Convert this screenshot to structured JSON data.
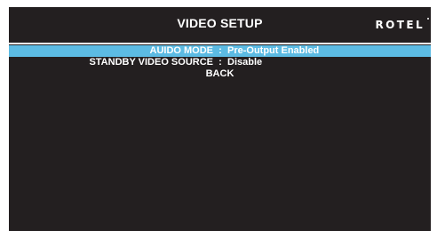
{
  "header": {
    "title": "VIDEO SETUP",
    "brand": "ROTEL"
  },
  "menu": {
    "items": [
      {
        "label": "AUIDO MODE",
        "separator": ":",
        "value": "Pre-Output Enabled",
        "selected": true
      },
      {
        "label": "STANDBY VIDEO SOURCE",
        "separator": ":",
        "value": "Disable",
        "selected": false
      },
      {
        "label": "BACK",
        "selected": false
      }
    ]
  },
  "colors": {
    "screen_background": "#231f20",
    "highlight": "#5cbbe3",
    "text": "#ffffff",
    "page_background": "#ffffff"
  }
}
